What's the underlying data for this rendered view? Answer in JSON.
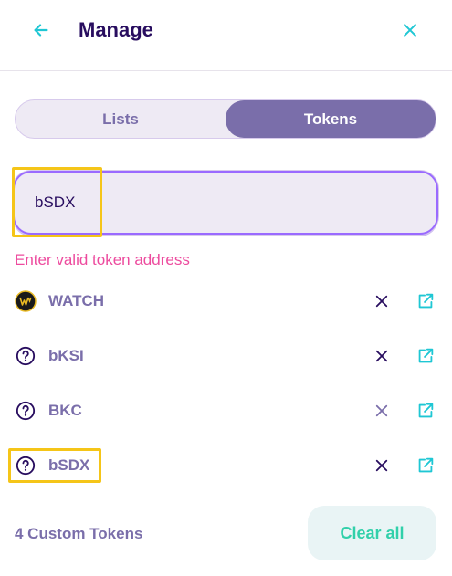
{
  "header": {
    "title": "Manage",
    "back_icon": "arrow-left-icon",
    "close_icon": "close-icon"
  },
  "tabs": [
    {
      "label": "Lists",
      "active": false
    },
    {
      "label": "Tokens",
      "active": true
    }
  ],
  "search": {
    "value": "bSDX",
    "placeholder": ""
  },
  "error": "Enter valid token address",
  "tokens": [
    {
      "name": "WATCH",
      "icon": "watch-logo-icon",
      "remove_icon": "close-icon",
      "link_icon": "open-new-icon"
    },
    {
      "name": "bKSI",
      "icon": "help-circle-icon",
      "remove_icon": "close-icon",
      "link_icon": "open-new-icon"
    },
    {
      "name": "BKC",
      "icon": "help-circle-icon",
      "remove_icon": "close-icon",
      "link_icon": "open-new-icon"
    },
    {
      "name": "bSDX",
      "icon": "help-circle-icon",
      "remove_icon": "close-icon",
      "link_icon": "open-new-icon"
    }
  ],
  "footer": {
    "count_label": "4 Custom Tokens",
    "clear_label": "Clear all"
  },
  "colors": {
    "primary": "#7A6EAA",
    "text": "#280D5F",
    "teal": "#31D0AA",
    "error": "#ED4B9E",
    "highlight": "#F5C518",
    "input_bg": "#EEEAF4",
    "focus": "#9A6AFF"
  }
}
